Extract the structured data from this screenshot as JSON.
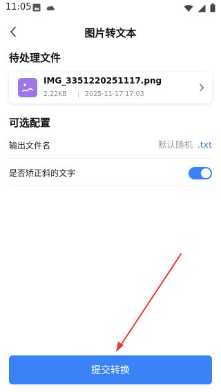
{
  "status_bar": {
    "time": "11:05"
  },
  "app_bar": {
    "title": "图片转文本"
  },
  "pending_section": {
    "title": "待处理文件",
    "file": {
      "name": "IMG_3351220251117.png",
      "size": "2.22KB",
      "date": "2025-11-17 17:03"
    }
  },
  "options_section": {
    "title": "可选配置",
    "output_name": {
      "label": "输出文件名",
      "placeholder": "默认随机",
      "extension": ".txt"
    },
    "deskew": {
      "label": "是否矫正斜的文字",
      "enabled": true
    }
  },
  "submit": {
    "label": "提交转换"
  },
  "colors": {
    "accent": "#3b82f6",
    "thumb": "#9d76e8",
    "annotation_arrow": "#e53935"
  },
  "icons": [
    "image-icon",
    "cloud-icon",
    "wifi-icon",
    "signal-icon",
    "battery-icon",
    "back-arrow-icon",
    "image-file-icon",
    "chevron-right-icon"
  ]
}
